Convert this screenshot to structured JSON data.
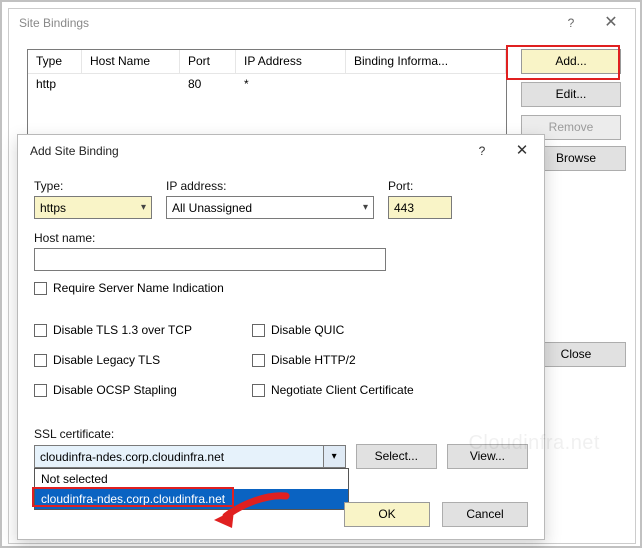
{
  "siteBindings": {
    "title": "Site Bindings",
    "help": "?",
    "close": "✕",
    "columns": {
      "type": "Type",
      "host": "Host Name",
      "port": "Port",
      "ip": "IP Address",
      "bind": "Binding Informa..."
    },
    "rows": [
      {
        "type": "http",
        "host": "",
        "port": "80",
        "ip": "*",
        "bind": ""
      }
    ],
    "buttons": {
      "add": "Add...",
      "edit": "Edit...",
      "remove": "Remove",
      "browse": "Browse",
      "close": "Close"
    }
  },
  "addBinding": {
    "title": "Add Site Binding",
    "help": "?",
    "close": "✕",
    "labels": {
      "type": "Type:",
      "ip": "IP address:",
      "port": "Port:",
      "hostname": "Host name:",
      "ssl": "SSL certificate:"
    },
    "values": {
      "type": "https",
      "ip": "All Unassigned",
      "port": "443",
      "hostname": "",
      "ssl_selected": "cloudinfra-ndes.corp.cloudinfra.net"
    },
    "checks": {
      "sni": "Require Server Name Indication",
      "tls13": "Disable TLS 1.3 over TCP",
      "legacy": "Disable Legacy TLS",
      "ocsp": "Disable OCSP Stapling",
      "quic": "Disable QUIC",
      "http2": "Disable HTTP/2",
      "negcert": "Negotiate Client Certificate"
    },
    "ssl_options": [
      "Not selected",
      "cloudinfra-ndes.corp.cloudinfra.net"
    ],
    "buttons": {
      "select": "Select...",
      "view": "View...",
      "ok": "OK",
      "cancel": "Cancel"
    }
  },
  "watermark": "Cloudinfra.net"
}
